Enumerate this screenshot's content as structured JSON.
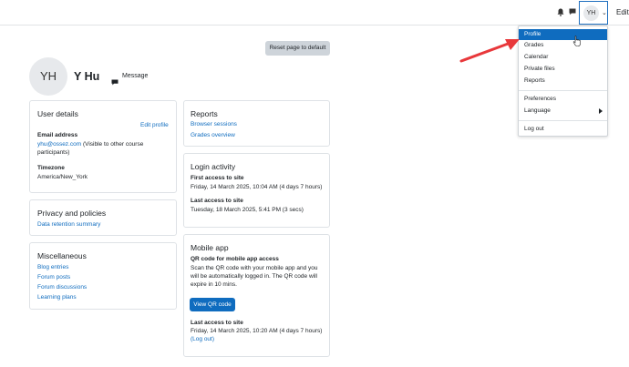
{
  "navbar": {
    "user_initials": "YH",
    "edit_mode_label": "Edit m",
    "icons": [
      "bell-icon",
      "chat-icon",
      "chevron-down-icon"
    ]
  },
  "reset_button_label": "Reset page to default",
  "profile": {
    "initials": "YH",
    "name": "Y Hu",
    "message_label": "Message"
  },
  "user_details": {
    "title": "User details",
    "edit_profile_label": "Edit profile",
    "email_heading": "Email address",
    "email_value": "yhu@ossez.com",
    "email_note_line1": "(Visible to other course",
    "email_note_line2": "participants)",
    "timezone_heading": "Timezone",
    "timezone_value": "America/New_York"
  },
  "privacy": {
    "title": "Privacy and policies",
    "link": "Data retention summary"
  },
  "misc": {
    "title": "Miscellaneous",
    "links": [
      "Blog entries",
      "Forum posts",
      "Forum discussions",
      "Learning plans"
    ]
  },
  "reports": {
    "title": "Reports",
    "links": [
      "Browser sessions",
      "Grades overview"
    ]
  },
  "login_activity": {
    "title": "Login activity",
    "first_heading": "First access to site",
    "first_value": "Friday, 14 March 2025, 10:04 AM  (4 days 7 hours)",
    "last_heading": "Last access to site",
    "last_value": "Tuesday, 18 March 2025, 5:41 PM  (3 secs)"
  },
  "mobile_app": {
    "title": "Mobile app",
    "qr_heading": "QR code for mobile app access",
    "qr_text_line1": "Scan the QR code with your mobile app and you",
    "qr_text_line2": "will be automatically logged in. The QR code will",
    "qr_text_line3": "expire in 10 mins.",
    "view_qr_label": "View QR code",
    "last_heading": "Last access to site",
    "last_value": "Friday, 14 March 2025, 10:20 AM  (4 days 7 hours)",
    "logout_label": "(Log out)"
  },
  "dropdown": {
    "items": [
      "Profile",
      "Grades",
      "Calendar",
      "Private files",
      "Reports"
    ],
    "items2": [
      "Preferences",
      "Language"
    ],
    "logout": "Log out"
  },
  "colors": {
    "accent": "#0f6cbf",
    "annotation": "#e8383b"
  }
}
